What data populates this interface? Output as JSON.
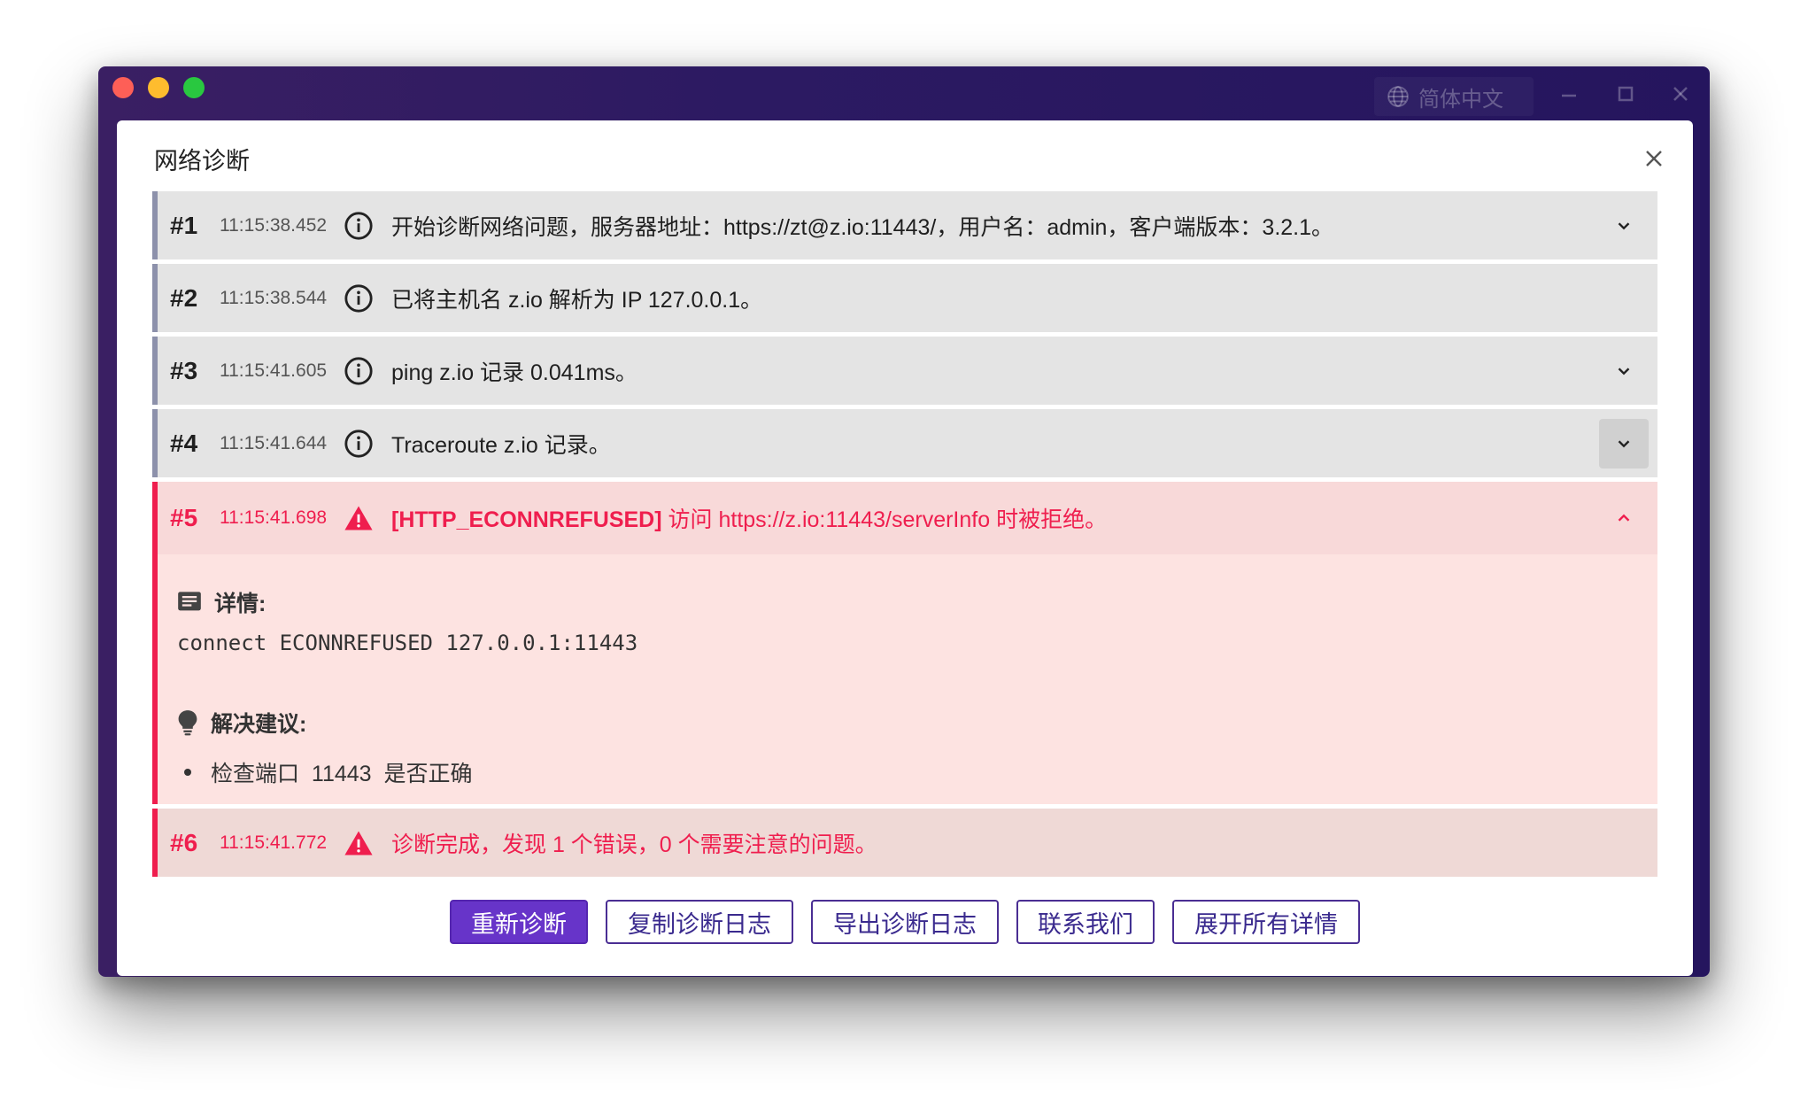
{
  "window": {
    "language_label": "简体中文",
    "icons": [
      "globe-icon",
      "minimize-icon",
      "maximize-icon",
      "close-icon"
    ]
  },
  "dialog": {
    "title": "网络诊断"
  },
  "log": [
    {
      "num": "#1",
      "time": "11:15:38.452",
      "level": "info",
      "message": "开始诊断网络问题，服务器地址：https://zt@z.io:11443/，用户名：admin，客户端版本：3.2.1。",
      "expandable": true
    },
    {
      "num": "#2",
      "time": "11:15:38.544",
      "level": "info",
      "message": "已将主机名 z.io 解析为 IP 127.0.0.1。",
      "expandable": false
    },
    {
      "num": "#3",
      "time": "11:15:41.605",
      "level": "info",
      "message": "ping z.io 记录 0.041ms。",
      "expandable": true
    },
    {
      "num": "#4",
      "time": "11:15:41.644",
      "level": "info",
      "message": "Traceroute z.io 记录。",
      "expandable": true
    },
    {
      "num": "#5",
      "time": "11:15:41.698",
      "level": "error",
      "code": "[HTTP_ECONNREFUSED]",
      "message": " 访问 https://z.io:11443/serverInfo 时被拒绝。",
      "expandable": true,
      "expanded": true
    },
    {
      "num": "#6",
      "time": "11:15:41.772",
      "level": "error",
      "message": "诊断完成，发现 1 个错误，0 个需要注意的问题。",
      "expandable": false
    }
  ],
  "detail": {
    "details_label": "详情:",
    "details_text": "connect ECONNREFUSED 127.0.0.1:11443",
    "suggestion_label": "解决建议:",
    "suggestion_item": "检查端口  11443  是否正确"
  },
  "buttons": {
    "rediagnose": "重新诊断",
    "copy_log": "复制诊断日志",
    "export_log": "导出诊断日志",
    "contact": "联系我们",
    "expand_all": "展开所有详情"
  },
  "colors": {
    "accent": "#6734c9",
    "error": "#ef1e4e",
    "titlebar": "#2c1a62"
  }
}
